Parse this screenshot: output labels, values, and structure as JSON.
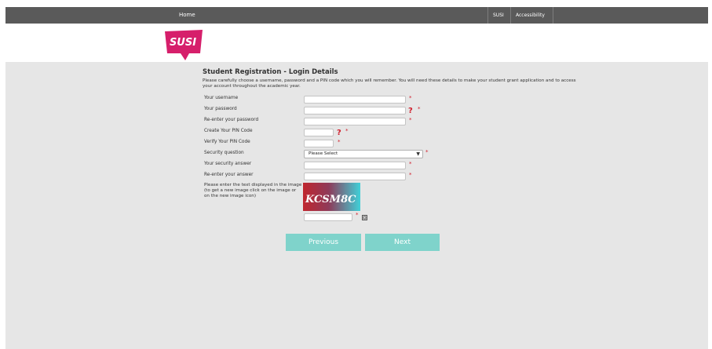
{
  "nav": {
    "home": "Home",
    "susi": "SUSI",
    "accessibility": "Accessibility"
  },
  "logo": {
    "text": "SUSI",
    "color": "#d61f6b"
  },
  "page": {
    "title": "Student Registration - Login Details",
    "intro": "Please carefully choose a username, password and a PIN code which you will remember. You will need these details to make your student grant application and to access your account throughout the academic year."
  },
  "form": {
    "username_label": "Your username",
    "password_label": "Your password",
    "reenter_password_label": "Re-enter your password",
    "create_pin_label": "Create Your PIN Code",
    "verify_pin_label": "Verify Your PIN Code",
    "security_question_label": "Security question",
    "security_question_value": "Please Select",
    "security_answer_label": "Your security answer",
    "reenter_answer_label": "Re-enter your answer",
    "captcha_label": "Please enter the text displayed in the image (to get a new image click on the image or on the new image icon)",
    "captcha_text": "KCSM8C",
    "required_marker": "*",
    "help_marker": "?"
  },
  "buttons": {
    "previous": "Previous",
    "next": "Next",
    "color": "#7fd3cb"
  },
  "colors": {
    "topbar": "#5a5a5a",
    "content_bg": "#e6e6e6",
    "required": "#d01e2c"
  }
}
